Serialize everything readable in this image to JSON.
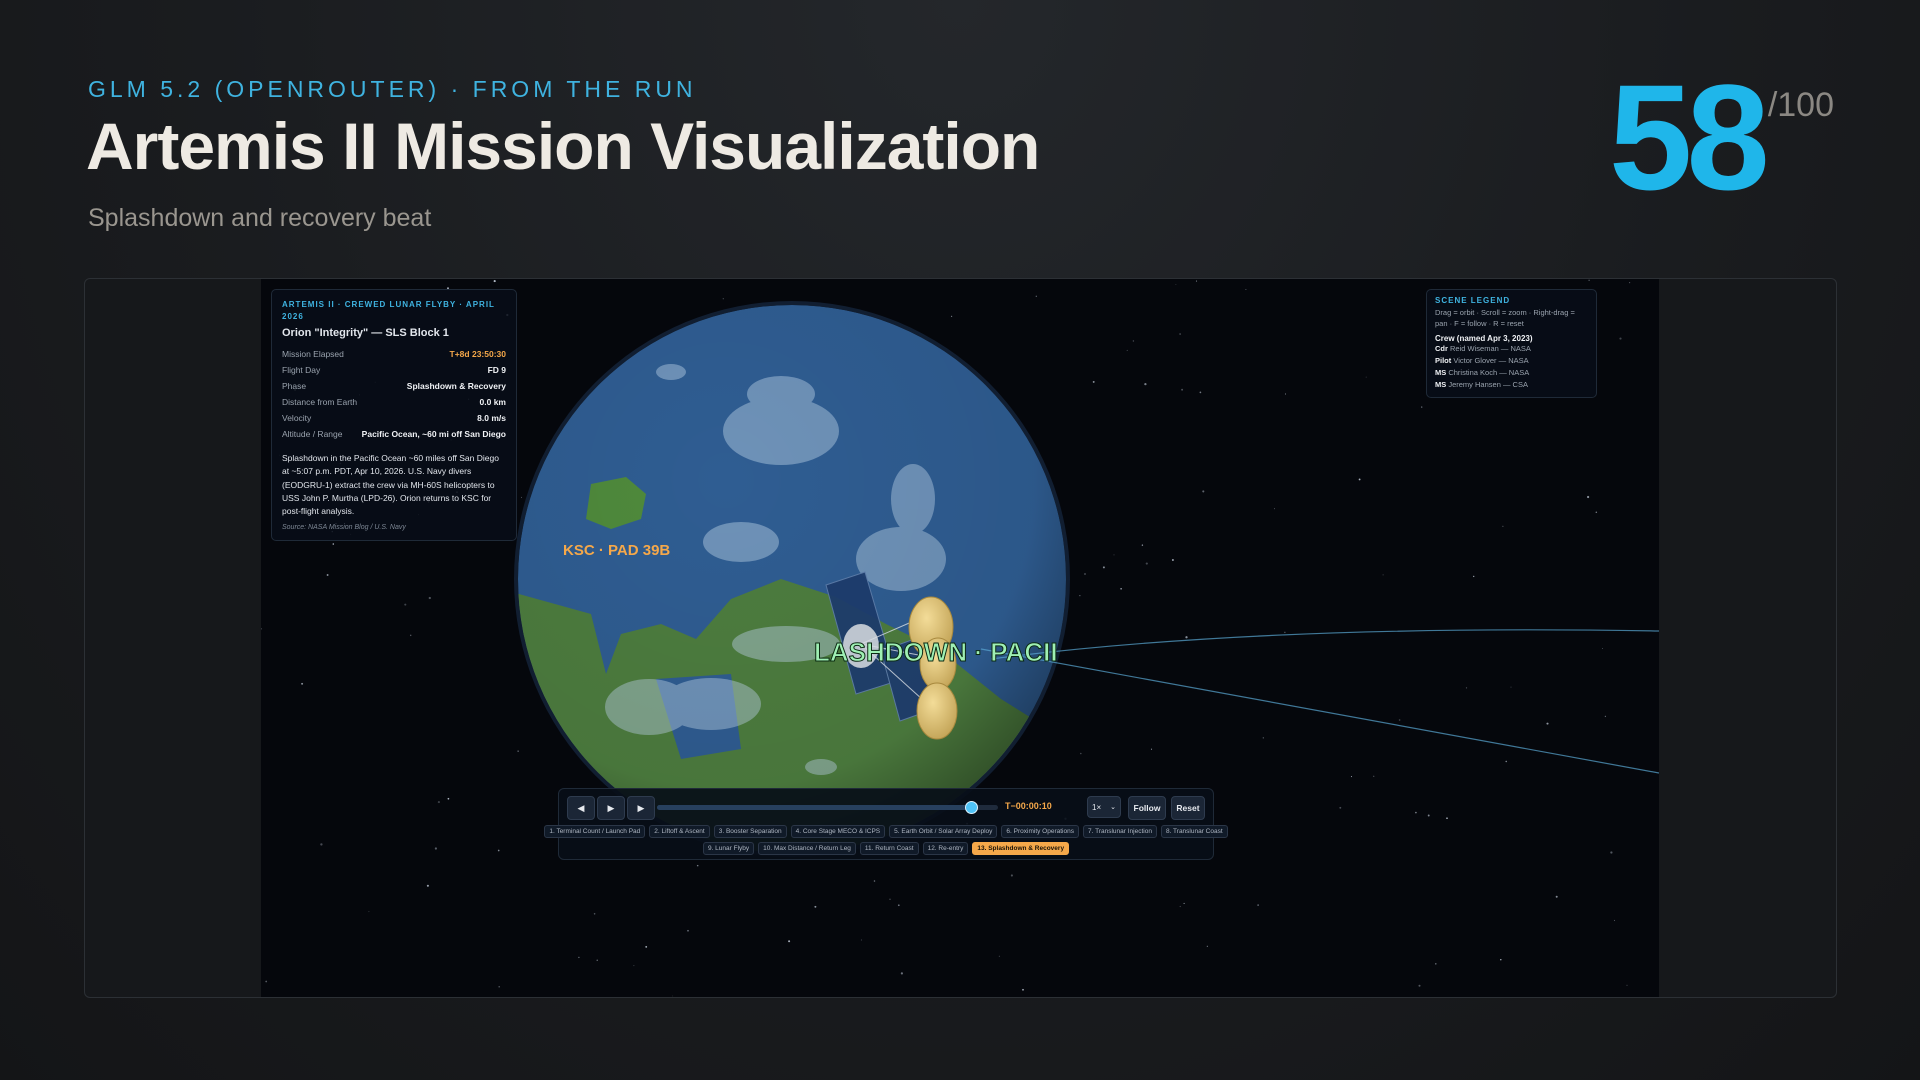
{
  "header": {
    "kicker": "GLM 5.2 (OPENROUTER) · FROM THE RUN",
    "title": "Artemis II Mission Visualization",
    "subtitle": "Splashdown and recovery beat",
    "score": "58",
    "score_max": "/100"
  },
  "scene": {
    "label_ksc": "KSC · PAD 39B",
    "label_splashdown": "LASHDOWN · PACII"
  },
  "info_panel": {
    "kicker": "ARTEMIS II · CREWED LUNAR FLYBY · APRIL 2026",
    "title": "Orion \"Integrity\" — SLS Block 1",
    "rows": [
      {
        "key": "Mission Elapsed",
        "value": "T+8d 23:50:30"
      },
      {
        "key": "Flight Day",
        "value": "FD 9"
      },
      {
        "key": "Phase",
        "value": "Splashdown & Recovery"
      },
      {
        "key": "Distance from Earth",
        "value": "0.0 km"
      },
      {
        "key": "Velocity",
        "value": "8.0 m/s"
      },
      {
        "key": "Altitude / Range",
        "value": "Pacific Ocean, ~60 mi off San Diego"
      }
    ],
    "description": "Splashdown in the Pacific Ocean ~60 miles off San Diego at ~5:07 p.m. PDT, Apr 10, 2026. U.S. Navy divers (EODGRU-1) extract the crew via MH-60S helicopters to USS John P. Murtha (LPD-26). Orion returns to KSC for post-flight analysis.",
    "source": "Source: NASA Mission Blog / U.S. Navy"
  },
  "legend": {
    "title": "SCENE LEGEND",
    "help": "Drag = orbit · Scroll = zoom · Right-drag = pan · F = follow · R = reset",
    "crew_heading": "Crew (named Apr 3, 2023)",
    "crew": [
      {
        "role": "Cdr",
        "name": "Reid Wiseman — NASA"
      },
      {
        "role": "Pilot",
        "name": "Victor Glover — NASA"
      },
      {
        "role": "MS",
        "name": "Christina Koch — NASA"
      },
      {
        "role": "MS",
        "name": "Jeremy Hansen — CSA"
      }
    ]
  },
  "controls": {
    "prev_icon": "◀",
    "play_icon": "▶",
    "next_icon": "▶",
    "timeline_progress": 0.92,
    "clock": "T−00:00:10",
    "speed": "1×",
    "follow_label": "Follow",
    "reset_label": "Reset",
    "phases_row1": [
      "1. Terminal Count / Launch Pad",
      "2. Liftoff & Ascent",
      "3. Booster Separation",
      "4. Core Stage MECO & ICPS",
      "5. Earth Orbit / Solar Array Deploy",
      "6. Proximity Operations",
      "7. Translunar Injection",
      "8. Translunar Coast"
    ],
    "phases_row2": [
      "9. Lunar Flyby",
      "10. Max Distance / Return Leg",
      "11. Return Coast",
      "12. Re-entry",
      "13. Splashdown & Recovery"
    ],
    "active_phase": "13. Splashdown & Recovery"
  },
  "colors": {
    "accent_blue": "#1fb6ea",
    "accent_orange": "#f5a84a",
    "splash_label": "#9ff0b4"
  }
}
